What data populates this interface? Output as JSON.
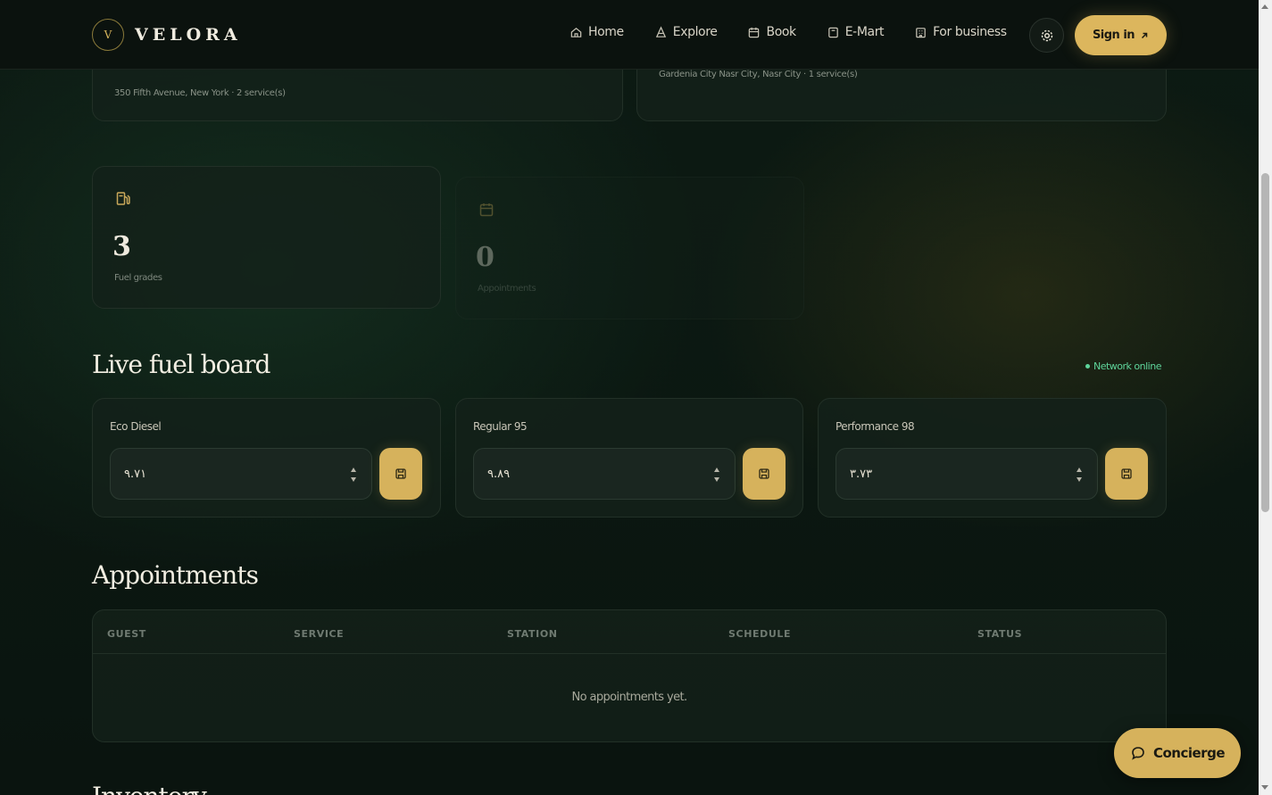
{
  "brand": {
    "mark": "V",
    "name": "VELORA"
  },
  "nav": {
    "items": [
      {
        "label": "Home",
        "icon": "home-icon"
      },
      {
        "label": "Explore",
        "icon": "explore-icon"
      },
      {
        "label": "Book",
        "icon": "calendar-icon"
      },
      {
        "label": "E-Mart",
        "icon": "shop-icon"
      },
      {
        "label": "For business",
        "icon": "building-icon"
      }
    ],
    "settings_icon": "settings-icon",
    "signin_label": "Sign in",
    "signin_icon": "arrow-up-right-icon"
  },
  "stations": [
    {
      "address": "350 Fifth Avenue, New York · 2 service(s)"
    },
    {
      "address": "Gardenia City Nasr City, Nasr City · 1 service(s)"
    }
  ],
  "stats": [
    {
      "value": "3",
      "label": "Fuel grades",
      "icon": "fuel-pump-icon"
    },
    {
      "value": "0",
      "label": "Appointments",
      "icon": "calendar-icon"
    }
  ],
  "fuel_board": {
    "title": "Live fuel board",
    "status": "Network online",
    "status_color": "#5ed49a",
    "grades": [
      {
        "name": "Eco Diesel",
        "price": "٩.٧١"
      },
      {
        "name": "Regular 95",
        "price": "٩.٨٩"
      },
      {
        "name": "Performance 98",
        "price": "٣.٧٣"
      }
    ]
  },
  "appointments": {
    "title": "Appointments",
    "columns": [
      "GUEST",
      "SERVICE",
      "STATION",
      "SCHEDULE",
      "STATUS"
    ],
    "empty_text": "No appointments yet."
  },
  "next_section": {
    "title": "Inventory"
  },
  "concierge": {
    "label": "Concierge",
    "icon": "chat-bubble-icon"
  },
  "colors": {
    "accent": "#d6b25c",
    "background": "#0b1711",
    "online": "#5ed49a"
  }
}
